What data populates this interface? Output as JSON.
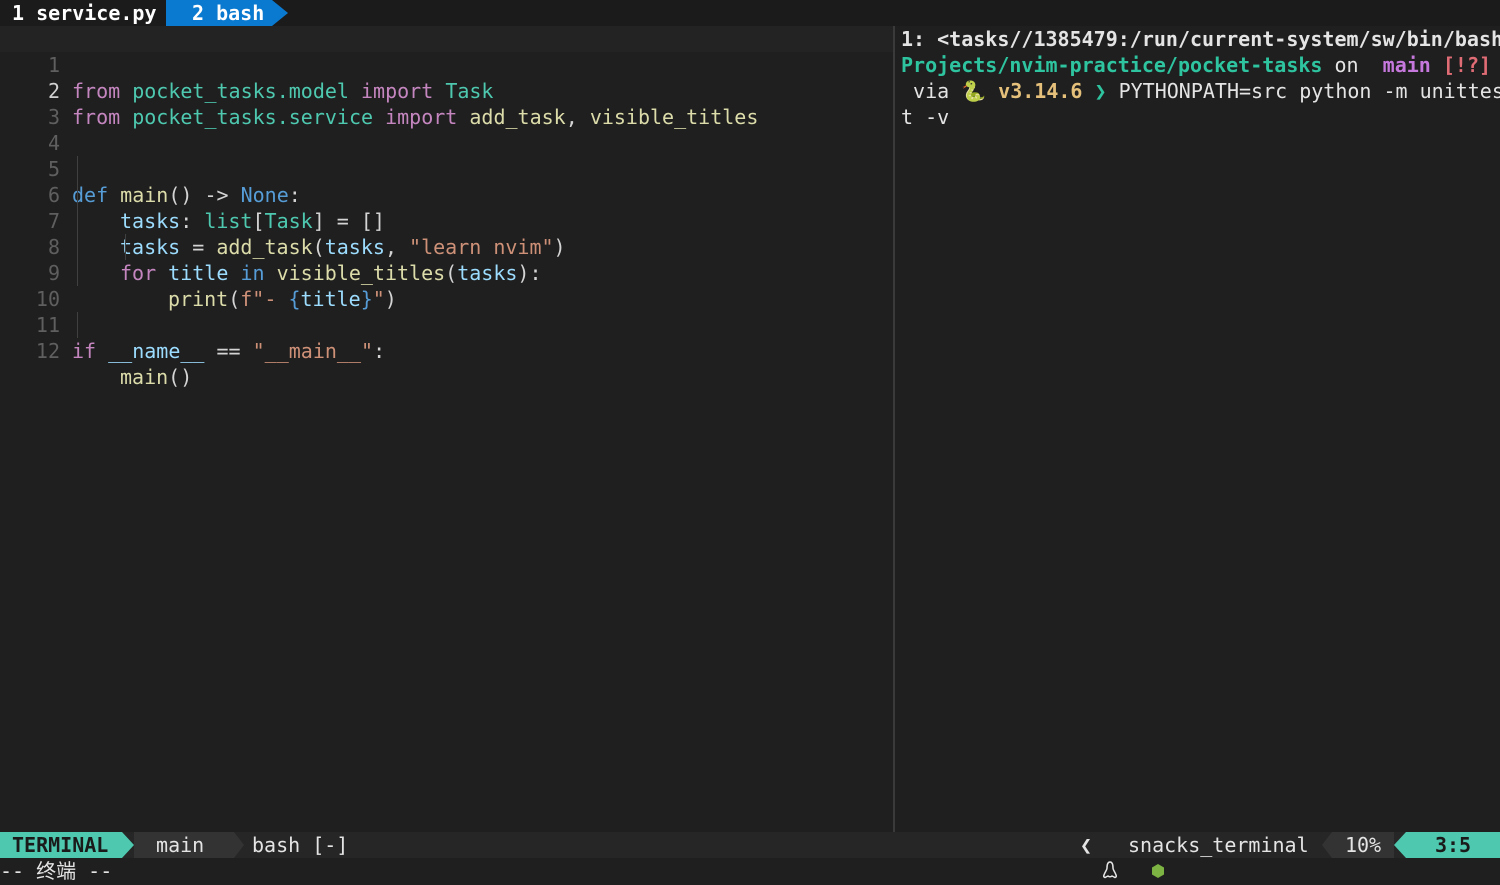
{
  "tabline": {
    "tab1": "1 service.py",
    "tab2": "2 bash"
  },
  "editor": {
    "current_line": 2,
    "lines": [
      {
        "num": "1"
      },
      {
        "num": "2"
      },
      {
        "num": "3"
      },
      {
        "num": "4"
      },
      {
        "num": "5"
      },
      {
        "num": "6"
      },
      {
        "num": "7"
      },
      {
        "num": "8"
      },
      {
        "num": "9"
      },
      {
        "num": "10"
      },
      {
        "num": "11"
      },
      {
        "num": "12"
      }
    ],
    "tokens": {
      "from": "from",
      "import": "import",
      "mod_model": "pocket_tasks.model",
      "mod_service": "pocket_tasks.service",
      "task": "Task",
      "add_task": "add_task",
      "comma": ",",
      "visible_titles": "visible_titles",
      "def": "def",
      "main": "main",
      "sig": "() -> ",
      "none": "None",
      "colon": ":",
      "tasks": "tasks",
      "list": "list",
      "lb": "[",
      "rb": "]",
      "eq_empty": " = []",
      "eq": " = ",
      "lp": "(",
      "comma_sp": ", ",
      "str_learn": "\"learn nvim\"",
      "rp": ")",
      "for": "for",
      "title": "title",
      "in": "in",
      "rp_colon": "):",
      "print": "print",
      "fpre": "f\"- ",
      "lbrace": "{",
      "rbrace": "}",
      "fpost": "\"",
      "if": "if",
      "dunder_name": "__name__",
      "eqeq": " == ",
      "str_main": "\"__main__\"",
      "call": "()"
    }
  },
  "terminal": {
    "title_line": "1: <tasks//1385479:/run/current-system/sw/bin/bash",
    "path": "Projects/nvim-practice/pocket-tasks",
    "on": " on ",
    "branch_icon": "",
    "branch": " main",
    "status": " [!?]",
    "via": " via ",
    "python_icon": "🐍",
    "version": " v3.14.6",
    "prompt_arrow": " ❯ ",
    "command": "PYTHONPATH=src python -m unittes",
    "command_wrap": "t -v"
  },
  "statusline": {
    "mode": "TERMINAL",
    "branch_icon": "",
    "branch": " main",
    "filename": "bash [-]",
    "os_icon": "",
    "sep": "❮",
    "filetype_icon": "",
    "filetype": "snacks_terminal",
    "percent": "10%",
    "position": "3:5"
  },
  "cmdline": {
    "text": "-- 终端 --"
  },
  "colors": {
    "mode_bg": "#4ec9b0",
    "tab_active_bg": "#0a7ad0",
    "background": "#1f1f1f"
  }
}
